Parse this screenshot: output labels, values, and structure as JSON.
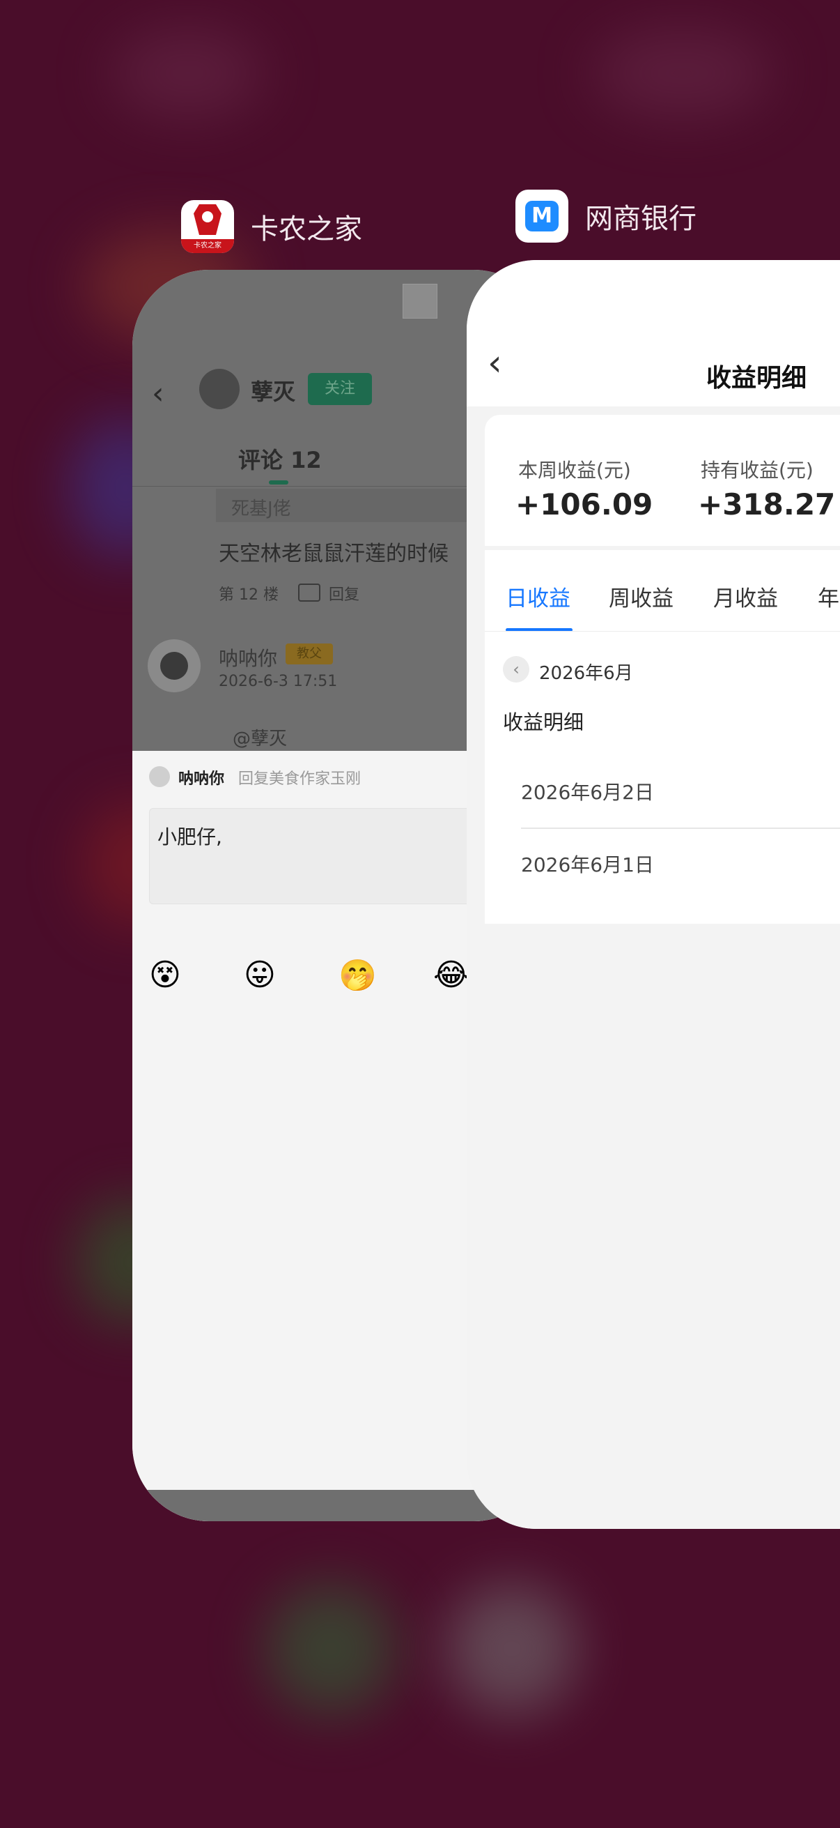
{
  "apps": {
    "left": {
      "name": "卡农之家",
      "icon": "kanong-app-icon",
      "icon_caption": "卡农之家"
    },
    "right": {
      "name": "网商银行",
      "icon": "mybank-app-icon"
    }
  },
  "kanong": {
    "author": "孽灭",
    "follow_label": "关注",
    "tab_label": "评论 12",
    "quote_user": "死基J佬",
    "comment_text": "天空林老鼠鼠汗莲的时候",
    "floor_label": "第 12 楼",
    "reply_label": "回复",
    "commenter_name": "呐呐你",
    "commenter_badge": "教父",
    "comment_time": "2026-6-3 17:51",
    "mention": "@孽灭",
    "composer": {
      "user": "呐呐你",
      "reply_hint": "回复美食作家玉刚",
      "input_value": "小肥仔,"
    },
    "emojis": [
      "😵",
      "😛",
      "🤭",
      "😂"
    ]
  },
  "mybank": {
    "page_title": "收益明细",
    "summary": [
      {
        "label": "本周收益(元)",
        "value": "+106.09"
      },
      {
        "label": "持有收益(元)",
        "value": "+318.27"
      }
    ],
    "tabs": [
      "日收益",
      "周收益",
      "月收益",
      "年"
    ],
    "active_tab": "日收益",
    "month": "2026年6月",
    "section_title": "收益明细",
    "days": [
      "2026年6月2日",
      "2026年6月1日"
    ],
    "accent": "#1677ff"
  }
}
